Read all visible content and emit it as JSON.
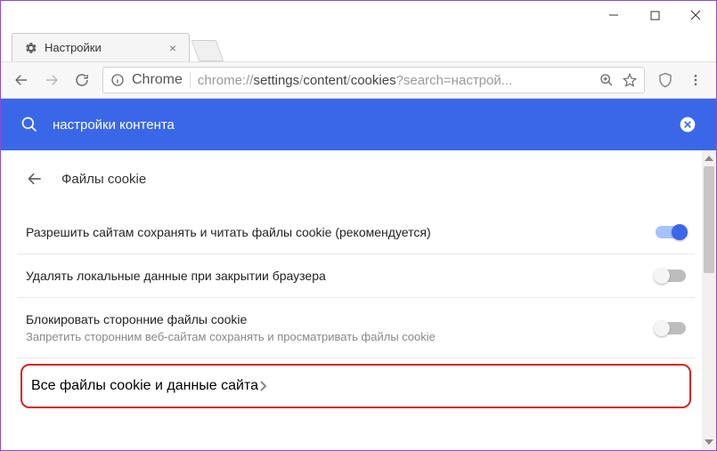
{
  "window": {
    "tab_title": "Настройки"
  },
  "omnibox": {
    "browser_label": "Chrome",
    "url_prefix": "chrome://",
    "url_seg1": "settings",
    "url_seg2": "content",
    "url_seg3": "cookies",
    "url_query": "?search=настрой..."
  },
  "searchbar": {
    "query": "настройки контента"
  },
  "page": {
    "title": "Файлы cookie"
  },
  "settings": [
    {
      "label": "Разрешить сайтам сохранять и читать файлы cookie (рекомендуется)",
      "sub": "",
      "enabled": true
    },
    {
      "label": "Удалять локальные данные при закрытии браузера",
      "sub": "",
      "enabled": false
    },
    {
      "label": "Блокировать сторонние файлы cookie",
      "sub": "Запретить сторонним веб-сайтам сохранять и просматривать файлы cookie",
      "enabled": false
    }
  ],
  "link_row": {
    "label": "Все файлы cookie и данные сайта"
  }
}
